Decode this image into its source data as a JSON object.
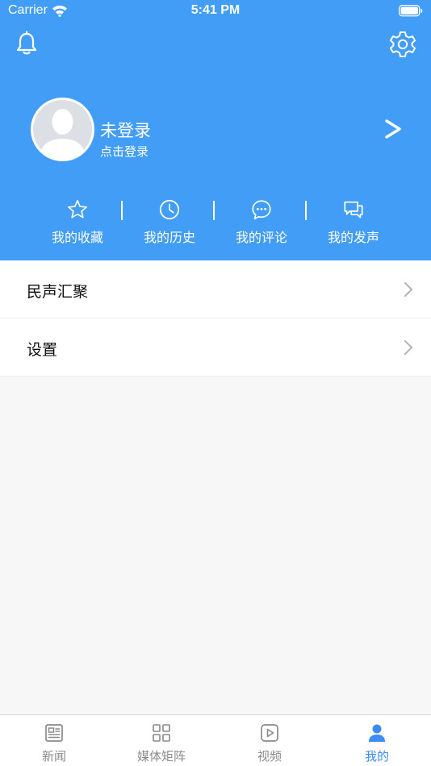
{
  "status_bar": {
    "carrier": "Carrier",
    "time": "5:41 PM"
  },
  "header": {
    "icons": [
      "bell-icon",
      "gear-icon"
    ],
    "background_color": "#429df7"
  },
  "profile": {
    "username": "未登录",
    "login_hint": "点击登录",
    "arrow": ">"
  },
  "shortcuts": [
    {
      "label": "我的收藏",
      "icon": "star-icon"
    },
    {
      "label": "我的历史",
      "icon": "clock-icon"
    },
    {
      "label": "我的评论",
      "icon": "comment-bubble-icon"
    },
    {
      "label": "我的发声",
      "icon": "chat-bubbles-icon"
    }
  ],
  "menu": [
    {
      "label": "民声汇聚",
      "icon": "chevron-right-icon"
    },
    {
      "label": "设置",
      "icon": "chevron-right-icon"
    }
  ],
  "tabbar": {
    "tabs": [
      {
        "label": "新闻",
        "icon": "newspaper-icon",
        "active": false
      },
      {
        "label": "媒体矩阵",
        "icon": "grid-icon",
        "active": false
      },
      {
        "label": "视频",
        "icon": "play-icon",
        "active": false
      },
      {
        "label": "我的",
        "icon": "person-icon",
        "active": true
      }
    ],
    "active_color": "#3b8cf5",
    "inactive_color": "#8a8a8a"
  }
}
